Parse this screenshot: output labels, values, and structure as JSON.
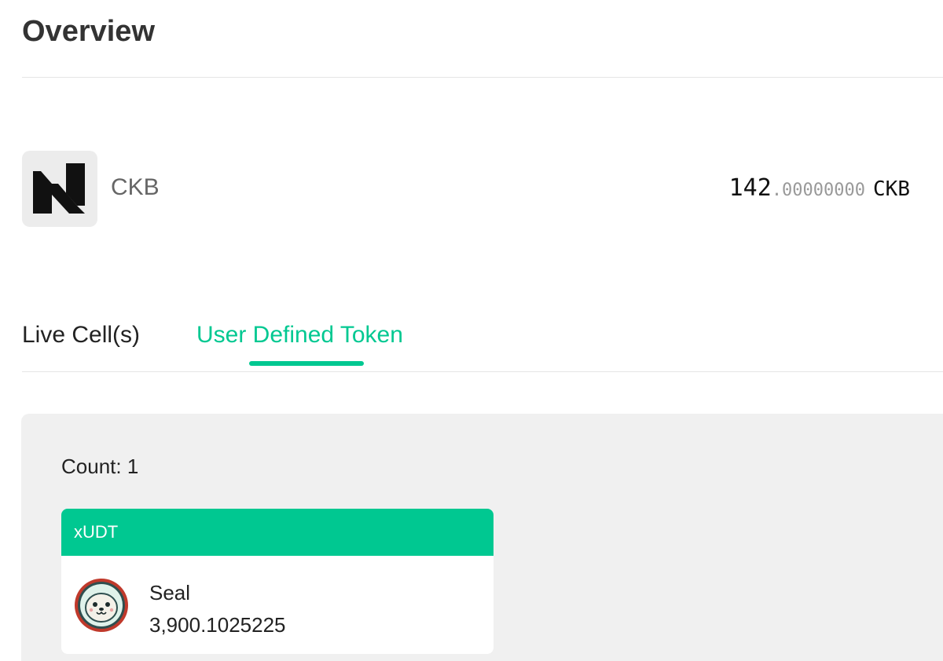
{
  "page": {
    "title": "Overview"
  },
  "asset": {
    "logo_icon": "nervos-logo-icon",
    "name": "CKB",
    "balance_integer": "142",
    "balance_decimal": ".00000000",
    "balance_unit": "CKB"
  },
  "tabs": [
    {
      "label": "Live Cell(s)",
      "active": false
    },
    {
      "label": "User Defined Token",
      "active": true
    }
  ],
  "udt_panel": {
    "count_text": "Count: 1",
    "tokens": [
      {
        "type_label": "xUDT",
        "icon": "seal-icon",
        "name": "Seal",
        "amount": "3,900.1025225"
      }
    ]
  },
  "colors": {
    "accent": "#00c891",
    "panel_bg": "#f0f0f0",
    "logo_bg": "#ececec",
    "seal_ring": "#c0392b"
  }
}
